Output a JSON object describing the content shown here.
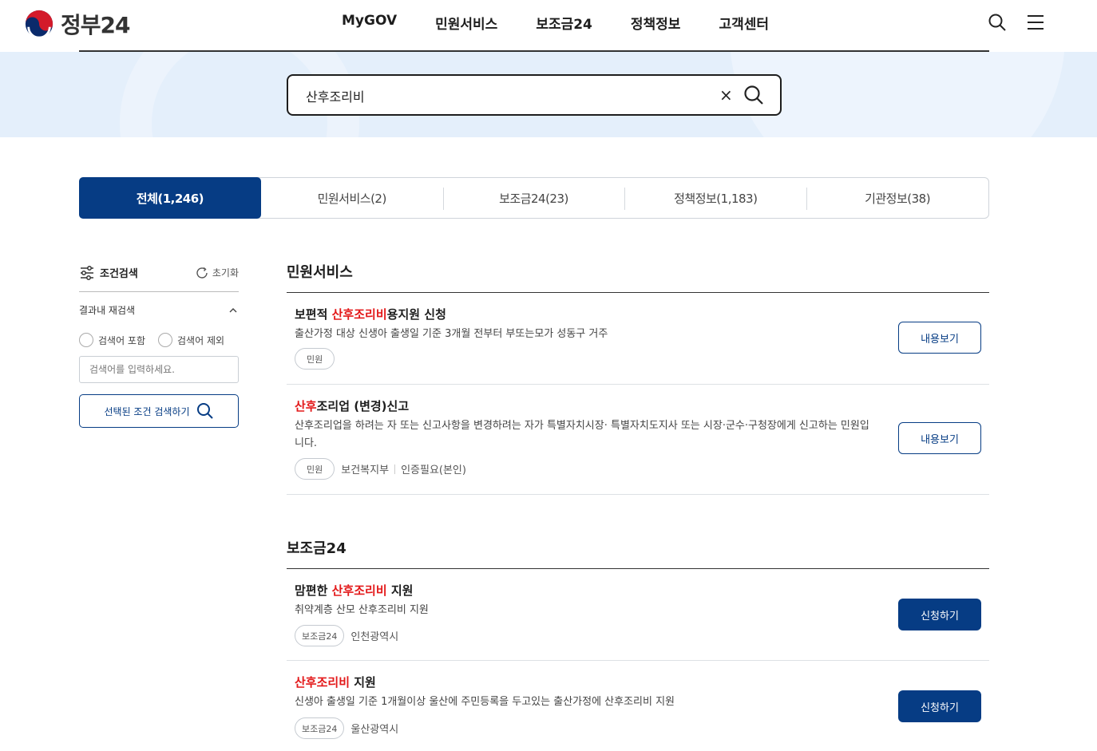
{
  "brand": {
    "name": "정부24"
  },
  "nav": [
    "MyGOV",
    "민원서비스",
    "보조금24",
    "정책정보",
    "고객센터"
  ],
  "search": {
    "query": "산후조리비",
    "clear": "×"
  },
  "tabs": [
    {
      "label": "전체(1,246)",
      "active": true
    },
    {
      "label": "민원서비스(2)",
      "active": false
    },
    {
      "label": "보조금24(23)",
      "active": false
    },
    {
      "label": "정책정보(1,183)",
      "active": false
    },
    {
      "label": "기관정보(38)",
      "active": false
    }
  ],
  "sidebar": {
    "title": "조건검색",
    "reset": "초기화",
    "refine_label": "결과내 재검색",
    "include_label": "검색어 포함",
    "exclude_label": "검색어 제외",
    "input_placeholder": "검색어를 입력하세요.",
    "search_button": "선택된 조건 검색하기"
  },
  "sections": {
    "civil": {
      "title": "민원서비스",
      "items": [
        {
          "title_pre": "보편적 ",
          "title_hl": "산후조리비",
          "title_post": "용지원 신청",
          "desc": "출산가정 대상 신생아 출생일 기준 3개월 전부터 부또는모가 성동구 거주",
          "badge": "민원",
          "meta": [],
          "button": "내용보기"
        },
        {
          "title_pre": "",
          "title_hl": "산후",
          "title_post": "조리업 (변경)신고",
          "desc": "산후조리업을 하려는 자 또는 신고사항을 변경하려는 자가 특별자치시장· 특별자치도지사 또는 시장·군수·구청장에게 신고하는 민원입니다.",
          "badge": "민원",
          "meta": [
            "보건복지부",
            "인증필요(본인)"
          ],
          "button": "내용보기"
        }
      ]
    },
    "subsidy": {
      "title": "보조금24",
      "items": [
        {
          "title_pre": "맘편한 ",
          "title_hl": "산후조리비",
          "title_post": " 지원",
          "desc": "취약계층 산모 산후조리비 지원",
          "badge": "보조금24",
          "meta": [
            "인천광역시"
          ],
          "button": "신청하기"
        },
        {
          "title_pre": "",
          "title_hl": "산후조리비",
          "title_post": " 지원",
          "desc": "신생아 출생일 기준 1개월이상 울산에 주민등록을 두고있는 출산가정에 산후조리비 지원",
          "badge": "보조금24",
          "meta": [
            "울산광역시"
          ],
          "button": "신청하기"
        }
      ]
    }
  },
  "colors": {
    "primary": "#063c84",
    "highlight": "#e3191a",
    "band": "#e4effb"
  },
  "icons": [
    "taegeuk-logo-icon",
    "search-icon",
    "menu-icon",
    "close-icon",
    "filter-icon",
    "refresh-icon",
    "chevron-up-icon"
  ]
}
